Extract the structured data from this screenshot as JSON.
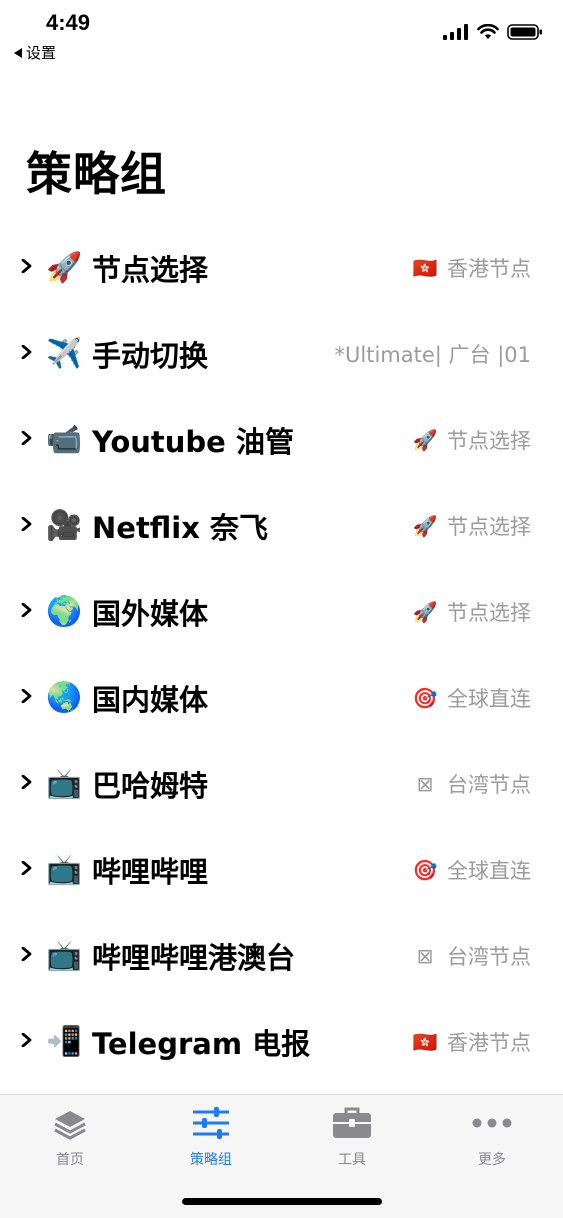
{
  "status_bar": {
    "time": "4:49",
    "back_app": "设置",
    "icons": [
      "cellular-signal-icon",
      "wifi-icon",
      "battery-icon"
    ]
  },
  "page": {
    "title": "策略组"
  },
  "groups": [
    {
      "icon": "🚀",
      "name": "节点选择",
      "value_icon": "🇭🇰",
      "value": "香港节点"
    },
    {
      "icon": "✈️",
      "name": "手动切换",
      "value_icon": "",
      "value": "*Ultimate| 广台 |01"
    },
    {
      "icon": "📹",
      "name": "Youtube 油管",
      "value_icon": "🚀",
      "value": "节点选择"
    },
    {
      "icon": "🎥",
      "name": "Netflix 奈飞",
      "value_icon": "🚀",
      "value": "节点选择"
    },
    {
      "icon": "🌍",
      "name": "国外媒体",
      "value_icon": "🚀",
      "value": "节点选择"
    },
    {
      "icon": "🌏",
      "name": "国内媒体",
      "value_icon": "🎯",
      "value": "全球直连"
    },
    {
      "icon": "📺",
      "name": "巴哈姆特",
      "value_icon": "⊠",
      "value": "台湾节点"
    },
    {
      "icon": "📺",
      "name": "哔哩哔哩",
      "value_icon": "🎯",
      "value": "全球直连"
    },
    {
      "icon": "📺",
      "name": "哔哩哔哩港澳台",
      "value_icon": "⊠",
      "value": "台湾节点"
    },
    {
      "icon": "📲",
      "name": "Telegram 电报",
      "value_icon": "🇭🇰",
      "value": "香港节点"
    }
  ],
  "tab_bar": {
    "tabs": [
      {
        "label": "首页",
        "icon": "layers-icon",
        "active": false
      },
      {
        "label": "策略组",
        "icon": "sliders-icon",
        "active": true
      },
      {
        "label": "工具",
        "icon": "toolbox-icon",
        "active": false
      },
      {
        "label": "更多",
        "icon": "more-dots-icon",
        "active": false
      }
    ]
  },
  "colors": {
    "accent": "#1f7bf2",
    "secondary_text": "#9b9b9b",
    "tab_inactive": "#8a8a8e"
  }
}
